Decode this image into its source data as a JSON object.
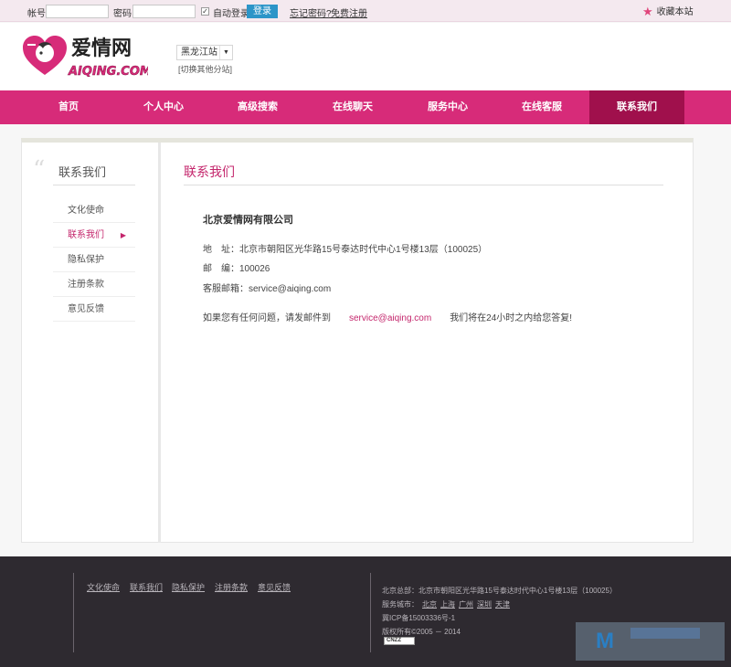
{
  "topbar": {
    "account_label": "帐号",
    "password_label": "密码",
    "auto_login_label": "自动登录",
    "login_button": "登录",
    "forgot_link": "忘记密码?",
    "register_link": "免费注册",
    "favorite_label": "收藏本站"
  },
  "header": {
    "logo_cn": "爱情网",
    "logo_en": "AIQING.COM",
    "city_selected": "黑龙江站",
    "city_switch": "[切换其他分站]"
  },
  "nav": {
    "items": [
      "首页",
      "个人中心",
      "高级搜索",
      "在线聊天",
      "服务中心",
      "在线客服",
      "联系我们"
    ],
    "active": "联系我们"
  },
  "sidebar": {
    "title": "联系我们",
    "items": [
      "文化使命",
      "联系我们",
      "隐私保护",
      "注册条款",
      "意见反馈"
    ],
    "active": "联系我们"
  },
  "main": {
    "title": "联系我们",
    "company": "北京爱情网有限公司",
    "address": "地　址：北京市朝阳区光华路15号泰达时代中心1号楼13层（100025）",
    "postcode": "邮　编：100026",
    "email_line": "客服邮箱：service@aiqing.com",
    "contact_prefix": "如果您有任何问题，请发邮件到",
    "contact_email": "service@aiqing.com",
    "contact_suffix": "我们将在24小时之内给您答复!"
  },
  "footer": {
    "links": [
      "文化使命",
      "联系我们",
      "隐私保护",
      "注册条款",
      "意见反馈"
    ],
    "hq": "北京总部：北京市朝阳区光华路15号泰达时代中心1号楼13层（100025）",
    "cities_label": "服务城市：",
    "cities": [
      "北京",
      "上海",
      "广州",
      "深圳",
      "天津"
    ],
    "icp": "冀ICP备15003336号-1",
    "copyright": "版权所有©2005 － 2014",
    "cnzz": "CNZZ"
  },
  "colors": {
    "brand_pink": "#d72b79",
    "nav_active": "#a0104c",
    "accent_text": "#c4266c",
    "login_blue": "#2c95c8",
    "footer_bg": "#2e2a30"
  }
}
